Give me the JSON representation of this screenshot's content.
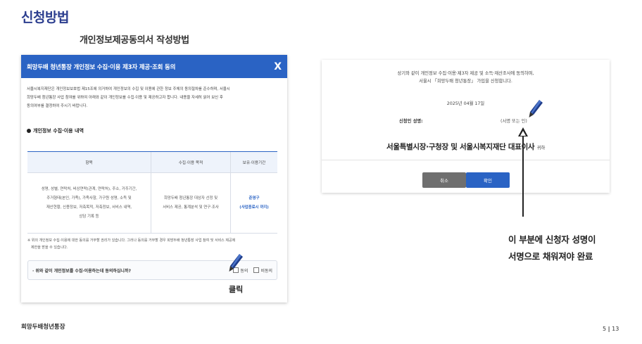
{
  "page": {
    "title": "신청방법",
    "subtitle": "개인정보제공동의서 작성방법"
  },
  "modal": {
    "title": "희망두배 청년통장 개인정보 수집·이용 제3자 제공·조회 동의",
    "close": "X",
    "intro_lines": [
      "서울시복지재단은 개인정보보호법 제15조에 의거하여 개인정보의 수집 및 이용에 관한 정보 주체의 동의절차를 준수하며, 서울시",
      "희망두배 청년통장 사업 참여를 위하여 아래와 같이 개인정보를 수집·이용 및 제공하고자 합니다. 내용을 자세히 읽어 보신 후",
      "동의여부를 결정하여 주시기 바랍니다."
    ],
    "section_heading": "개인정보 수집·이용 내역",
    "table": {
      "headers": [
        "항목",
        "수집·이용 목적",
        "보유·이용기간"
      ],
      "items_lines": [
        "성명, 성별, 연락처, 비상연락(관계, 연락처), 주소, 거주기간,",
        "주거형태(본인, 가족), 가족사항, 가구원 성명, 소득 및",
        "재산현황, 신용정보, 저축목적, 저축정보, 서비스 내역,",
        "상담 기록 등"
      ],
      "purpose_lines": [
        "희망두배 청년통장 대상자 선정 및",
        "서비스 제공, 통계분석 및 연구·조사"
      ],
      "retention_lines": [
        "준영구",
        "(사업종료시 까지)"
      ]
    },
    "note_lines": [
      "※ 위의 개인정보 수집·이용에 대한 동의를 거부할 권리가 있습니다. 그러나 동의를 거부할 경우 희망두배 청년통장 사업 참여 및 서비스 제공에",
      "제한을 받을 수 있습니다."
    ],
    "consent_question": "· 위와 같이 개인정보를 수집·이용하는데 동의하십니까?",
    "agree_label": "동의",
    "disagree_label": "비동의"
  },
  "click_label": "클릭",
  "confirm_panel": {
    "agree_lines": [
      "상기와 같이 개인정보 수집·이용·제3자 제공 및 소득·재산조사에 동의하며,",
      "서울시 「희망두배 청년통장」 가입을 신청합니다."
    ],
    "date": "2025년 04월 17일",
    "signer_label": "신청인 성명:",
    "signature_hint": "(서명 또는 인)",
    "addressee": "서울특별시장·구청장 및 서울시복지재단 대표이사",
    "addressee_suffix": "귀하",
    "cancel_button": "취소",
    "confirm_button": "확인"
  },
  "callout_lines": [
    "이 부분에 신청자 성명이",
    "서명으로 채워져야 완료"
  ],
  "footer": {
    "brand": "희망두배청년통장",
    "page_current": "5",
    "page_separator": "|",
    "page_total": "13"
  },
  "colors": {
    "title_blue": "#2c3e8f",
    "header_blue": "#2a63c4",
    "cancel_gray": "#6f6f6f"
  },
  "icons": [
    "close-icon",
    "pen-icon",
    "checkbox-icon",
    "arrow-up-icon"
  ]
}
